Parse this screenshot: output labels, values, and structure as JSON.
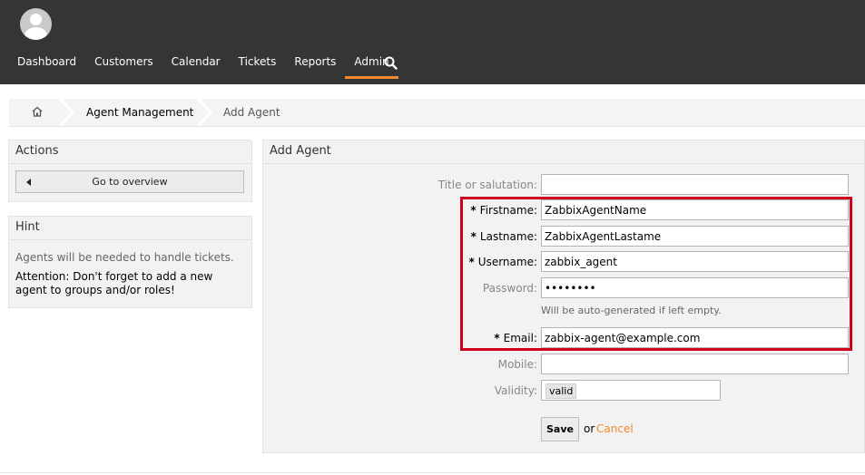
{
  "nav": {
    "items": [
      {
        "label": "Dashboard"
      },
      {
        "label": "Customers"
      },
      {
        "label": "Calendar"
      },
      {
        "label": "Tickets"
      },
      {
        "label": "Reports"
      },
      {
        "label": "Admin",
        "active": true
      }
    ],
    "search_icon": "search-icon"
  },
  "breadcrumb": {
    "home_icon": "home-icon",
    "items": [
      {
        "label": "Agent Management"
      },
      {
        "label": "Add Agent"
      }
    ]
  },
  "actions": {
    "title": "Actions",
    "overview_label": "Go to overview"
  },
  "hint": {
    "title": "Hint",
    "line1": "Agents will be needed to handle tickets.",
    "line2": "Attention: Don't forget to add a new agent to groups and/or roles!"
  },
  "form": {
    "title": "Add Agent",
    "required_star": "*",
    "fields": {
      "title": {
        "label": "Title or salutation:",
        "value": ""
      },
      "firstname": {
        "label": "Firstname:",
        "value": "ZabbixAgentName"
      },
      "lastname": {
        "label": "Lastname:",
        "value": "ZabbixAgentLastame"
      },
      "username": {
        "label": "Username:",
        "value": "zabbix_agent"
      },
      "password": {
        "label": "Password:",
        "value": "••••••••",
        "help": "Will be auto-generated if left empty."
      },
      "email": {
        "label": "Email:",
        "value": "zabbix-agent@example.com"
      },
      "mobile": {
        "label": "Mobile:",
        "value": ""
      },
      "validity": {
        "label": "Validity:",
        "value": "valid"
      }
    },
    "save_label": "Save",
    "or_text": "or",
    "cancel_label": "Cancel"
  },
  "colors": {
    "header_bg": "#353535",
    "accent": "#f28a2c",
    "highlight": "#d0021b"
  }
}
